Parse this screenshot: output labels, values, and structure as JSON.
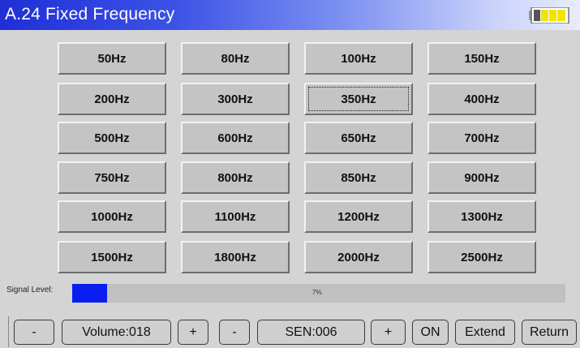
{
  "header": {
    "title": "A.24 Fixed Frequency",
    "icon": "battery-icon",
    "battery_color": "#f2e400"
  },
  "frequency_grid": {
    "selected": "350Hz",
    "rows": [
      [
        "50Hz",
        "80Hz",
        "100Hz",
        "150Hz"
      ],
      [
        "200Hz",
        "300Hz",
        "350Hz",
        "400Hz"
      ],
      [
        "500Hz",
        "600Hz",
        "650Hz",
        "700Hz"
      ],
      [
        "750Hz",
        "800Hz",
        "850Hz",
        "900Hz"
      ],
      [
        "1000Hz",
        "1100Hz",
        "1200Hz",
        "1300Hz"
      ],
      [
        "1500Hz",
        "1800Hz",
        "2000Hz",
        "2500Hz"
      ]
    ]
  },
  "signal": {
    "label": "Signal Level:",
    "percent_text": "7%",
    "level_fraction": 0.07,
    "fill_color": "#0a1ef0"
  },
  "toolbar": {
    "volume_minus": "-",
    "volume_display": "Volume:018",
    "volume_plus": "+",
    "sen_minus": "-",
    "sen_display": "SEN:006",
    "sen_plus": "+",
    "on": "ON",
    "extend": "Extend",
    "return": "Return"
  }
}
